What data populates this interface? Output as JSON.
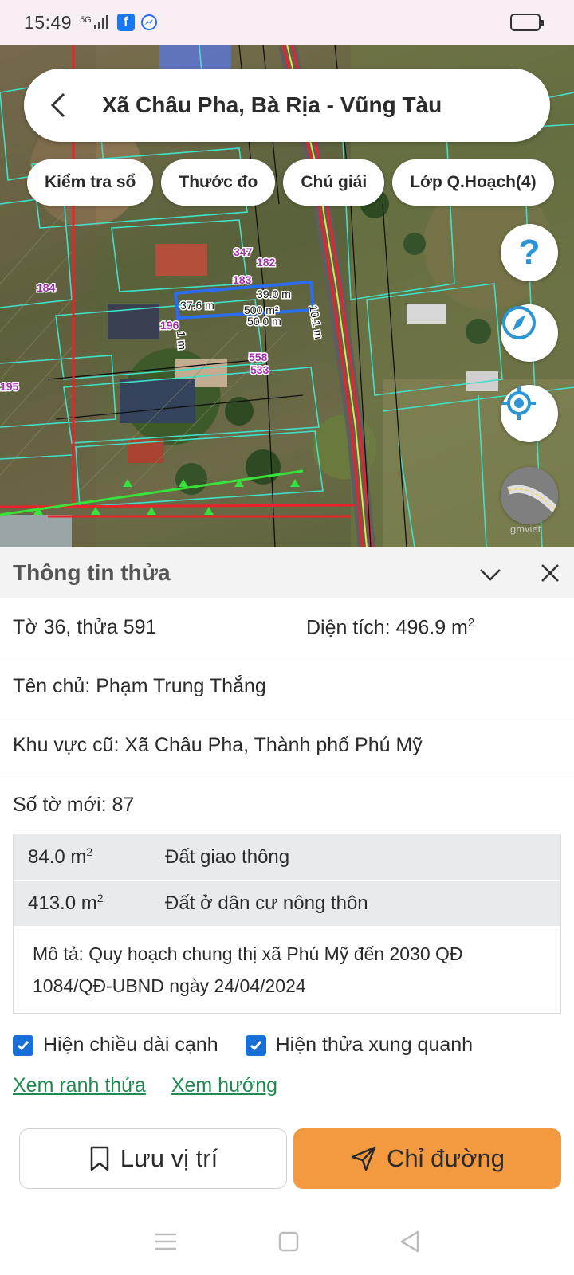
{
  "status_bar": {
    "time": "15:49",
    "network": "5G"
  },
  "header": {
    "title": "Xã Châu Pha, Bà Rịa - Vũng Tàu"
  },
  "chips": [
    "Kiểm tra sổ",
    "Thước đo",
    "Chú giải",
    "Lớp Q.Hoạch(4)"
  ],
  "fabs": {
    "help_label": "?"
  },
  "map_labels": {
    "parcel_184": "184",
    "parcel_195": "195",
    "parcel_182": "182",
    "parcel_183": "183",
    "parcel_347": "347",
    "parcel_196": "196",
    "parcel_558": "558",
    "parcel_533": "533",
    "edge_top": "39.0 m",
    "edge_left": "37.6 m",
    "edge_right": "10.1 m",
    "edge_bottom": "50.0 m",
    "area": "500 m²",
    "side_small": "1 m",
    "watermark": "gmviet"
  },
  "panel": {
    "title": "Thông tin thửa",
    "sheet_parcel": "Tờ 36, thửa 591",
    "area_label": "Diện tích: 496.9 m",
    "area_sup": "2",
    "owner": "Tên chủ: Phạm Trung Thắng",
    "old_area": "Khu vực cũ: Xã Châu Pha, Thành phố Phú Mỹ",
    "new_sheet": "Số tờ mới: 87",
    "land_uses": [
      {
        "area": "84.0 m",
        "sup": "2",
        "type": "Đất giao thông"
      },
      {
        "area": "413.0 m",
        "sup": "2",
        "type": "Đất ở dân cư nông thôn"
      }
    ],
    "description": "Mô tả: Quy hoạch chung thị xã Phú Mỹ đến 2030 QĐ 1084/QĐ-UBND ngày 24/04/2024",
    "checkbox_edge": "Hiện chiều dài cạnh",
    "checkbox_neighbors": "Hiện thửa xung quanh",
    "link_boundary": "Xem ranh thửa",
    "link_direction": "Xem hướng",
    "save_button": "Lưu vị trí",
    "route_button": "Chỉ đường"
  },
  "colors": {
    "accent_orange": "#f39a40",
    "link_green": "#1f8a50",
    "checkbox_blue": "#1a6fd6",
    "parcel_line": "#41e0c9",
    "boundary_red": "#e8242a"
  }
}
